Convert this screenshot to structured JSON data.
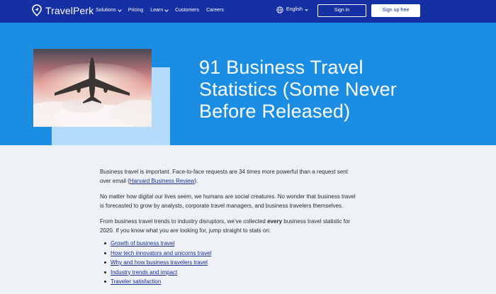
{
  "nav": {
    "logo_text": "TravelPerk",
    "items": [
      {
        "label": "Solutions",
        "dropdown": true
      },
      {
        "label": "Pricing",
        "dropdown": false
      },
      {
        "label": "Learn",
        "dropdown": true
      },
      {
        "label": "Customers",
        "dropdown": false
      },
      {
        "label": "Careers",
        "dropdown": false
      }
    ],
    "language": "English",
    "sign_in": "Sign in",
    "sign_up": "Sign up free"
  },
  "hero": {
    "title": "91 Business Travel Statistics (Some Never Before Released)"
  },
  "article": {
    "p1_text": "Business travel is important. Face-to-face requests are 34 times more powerful than a request sent over email (",
    "p1_link": "Harvard Business Review",
    "p1_end": ").",
    "p2": "No matter how digital our lives seem, we humans are social creatures. No wonder that business travel is forecasted to grow by analysts, corporate travel managers, and business travelers themselves.",
    "p3_start": "From business travel trends to industry disruptors, we’ve collected ",
    "p3_bold": "every",
    "p3_end": " business travel statistic for 2020. If you know what you are looking for, jump straight to stats on:",
    "toc": [
      "Growth of business travel",
      "How tech innovators and unicorns travel",
      "Why and how business travelers travel",
      "Industry trends and impact",
      "Traveler satisfaction"
    ]
  },
  "colors": {
    "nav_bg": "#1530a3",
    "hero_bg": "#1b8de2",
    "hero_accent": "#b4dcfa",
    "page_bg": "#eef1f5",
    "link": "#1a2d8f"
  },
  "icons": [
    "travelperk-logo-icon",
    "globe-icon",
    "chevron-down-icon"
  ]
}
